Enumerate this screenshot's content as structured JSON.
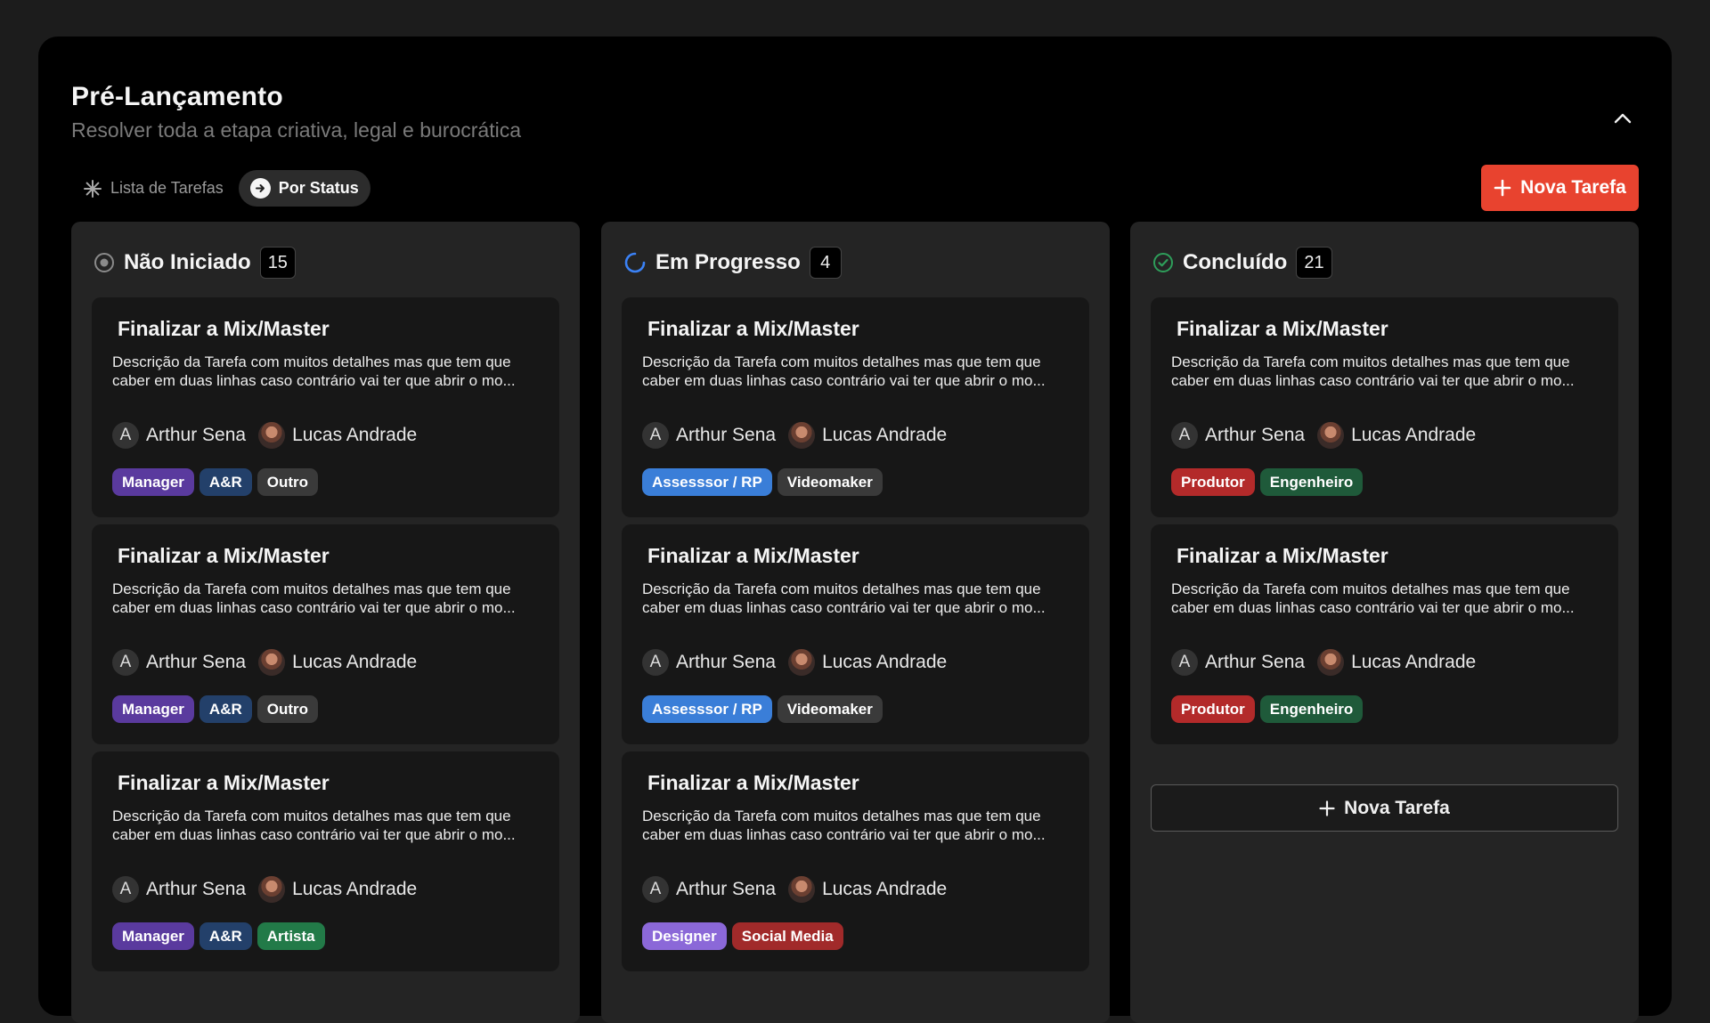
{
  "header": {
    "title": "Pré-Lançamento",
    "subtitle": "Resolver toda a etapa criativa, legal e burocrática"
  },
  "view_toggle": {
    "list_label": "Lista de Tarefas",
    "status_label": "Por Status",
    "active": "status"
  },
  "new_task_label": "Nova Tarefa",
  "icons": {
    "collapse": "chevron-up-icon",
    "list": "asterisk-icon",
    "status": "arrow-circle-icon",
    "add": "plus-icon",
    "not_started": "circle-dot-icon",
    "in_progress": "spinner-icon",
    "done": "check-circle-icon"
  },
  "colors": {
    "accent": "#e8432f",
    "manager": "#5a3a9e",
    "ar": "#23406a",
    "outro": "#3a3a3a",
    "artista": "#227a48",
    "assessor": "#3a7ed8",
    "videomaker": "#3a3a3a",
    "designer": "#8b68d8",
    "social_media": "#a12a2a",
    "produtor": "#b32a2a",
    "engenheiro": "#1f5a3a"
  },
  "columns": [
    {
      "title": "Não Iniciado",
      "count": "15",
      "cards": [
        {
          "title": "Finalizar a Mix/Master",
          "description": "Descrição da Tarefa com muitos detalhes mas que tem que caber em duas linhas caso contrário vai ter que abrir o mo...",
          "assignees": [
            {
              "initial": "A",
              "name": "Arthur Sena"
            },
            {
              "name": "Lucas Andrade"
            }
          ],
          "tags": [
            {
              "label": "Manager",
              "color": "#5a3a9e"
            },
            {
              "label": "A&R",
              "color": "#23406a"
            },
            {
              "label": "Outro",
              "color": "#3a3a3a"
            }
          ]
        },
        {
          "title": "Finalizar a Mix/Master",
          "description": "Descrição da Tarefa com muitos detalhes mas que tem que caber em duas linhas caso contrário vai ter que abrir o mo...",
          "assignees": [
            {
              "initial": "A",
              "name": "Arthur Sena"
            },
            {
              "name": "Lucas Andrade"
            }
          ],
          "tags": [
            {
              "label": "Manager",
              "color": "#5a3a9e"
            },
            {
              "label": "A&R",
              "color": "#23406a"
            },
            {
              "label": "Outro",
              "color": "#3a3a3a"
            }
          ]
        },
        {
          "title": "Finalizar a Mix/Master",
          "description": "Descrição da Tarefa com muitos detalhes mas que tem que caber em duas linhas caso contrário vai ter que abrir o mo...",
          "assignees": [
            {
              "initial": "A",
              "name": "Arthur Sena"
            },
            {
              "name": "Lucas Andrade"
            }
          ],
          "tags": [
            {
              "label": "Manager",
              "color": "#5a3a9e"
            },
            {
              "label": "A&R",
              "color": "#23406a"
            },
            {
              "label": "Artista",
              "color": "#227a48"
            }
          ]
        }
      ]
    },
    {
      "title": "Em Progresso",
      "count": "4",
      "cards": [
        {
          "title": "Finalizar a Mix/Master",
          "description": "Descrição da Tarefa com muitos detalhes mas que tem que caber em duas linhas caso contrário vai ter que abrir o mo...",
          "assignees": [
            {
              "initial": "A",
              "name": "Arthur Sena"
            },
            {
              "name": "Lucas Andrade"
            }
          ],
          "tags": [
            {
              "label": "Assesssor / RP",
              "color": "#3a7ed8"
            },
            {
              "label": "Videomaker",
              "color": "#3a3a3a"
            }
          ]
        },
        {
          "title": "Finalizar a Mix/Master",
          "description": "Descrição da Tarefa com muitos detalhes mas que tem que caber em duas linhas caso contrário vai ter que abrir o mo...",
          "assignees": [
            {
              "initial": "A",
              "name": "Arthur Sena"
            },
            {
              "name": "Lucas Andrade"
            }
          ],
          "tags": [
            {
              "label": "Assesssor / RP",
              "color": "#3a7ed8"
            },
            {
              "label": "Videomaker",
              "color": "#3a3a3a"
            }
          ]
        },
        {
          "title": "Finalizar a Mix/Master",
          "description": "Descrição da Tarefa com muitos detalhes mas que tem que caber em duas linhas caso contrário vai ter que abrir o mo...",
          "assignees": [
            {
              "initial": "A",
              "name": "Arthur Sena"
            },
            {
              "name": "Lucas Andrade"
            }
          ],
          "tags": [
            {
              "label": "Designer",
              "color": "#8b68d8"
            },
            {
              "label": "Social Media",
              "color": "#a12a2a"
            }
          ]
        }
      ]
    },
    {
      "title": "Concluído",
      "count": "21",
      "add_label": "Nova Tarefa",
      "cards": [
        {
          "title": "Finalizar a Mix/Master",
          "description": "Descrição da Tarefa com muitos detalhes mas que tem que caber em duas linhas caso contrário vai ter que abrir o mo...",
          "assignees": [
            {
              "initial": "A",
              "name": "Arthur Sena"
            },
            {
              "name": "Lucas Andrade"
            }
          ],
          "tags": [
            {
              "label": "Produtor",
              "color": "#b32a2a"
            },
            {
              "label": "Engenheiro",
              "color": "#1f5a3a"
            }
          ]
        },
        {
          "title": "Finalizar a Mix/Master",
          "description": "Descrição da Tarefa com muitos detalhes mas que tem que caber em duas linhas caso contrário vai ter que abrir o mo...",
          "assignees": [
            {
              "initial": "A",
              "name": "Arthur Sena"
            },
            {
              "name": "Lucas Andrade"
            }
          ],
          "tags": [
            {
              "label": "Produtor",
              "color": "#b32a2a"
            },
            {
              "label": "Engenheiro",
              "color": "#1f5a3a"
            }
          ]
        }
      ]
    }
  ]
}
